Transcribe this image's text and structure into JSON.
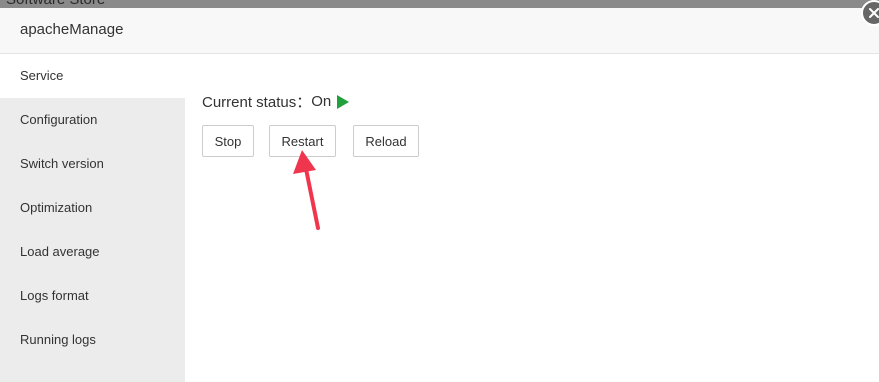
{
  "background_window": {
    "title": "Software Store"
  },
  "dialog": {
    "title": "apacheManage"
  },
  "sidebar": {
    "items": [
      {
        "label": "Service",
        "active": true
      },
      {
        "label": "Configuration"
      },
      {
        "label": "Switch version"
      },
      {
        "label": "Optimization"
      },
      {
        "label": "Load average"
      },
      {
        "label": "Logs format"
      },
      {
        "label": "Running logs"
      }
    ]
  },
  "service": {
    "status_label": "Current status：",
    "status_value": "On",
    "status_icon": "play-icon",
    "status_color": "#21a03c",
    "buttons": {
      "stop": "Stop",
      "restart": "Restart",
      "reload": "Reload"
    }
  },
  "annotation": {
    "arrow_color": "#f0364f",
    "target": "Restart"
  }
}
